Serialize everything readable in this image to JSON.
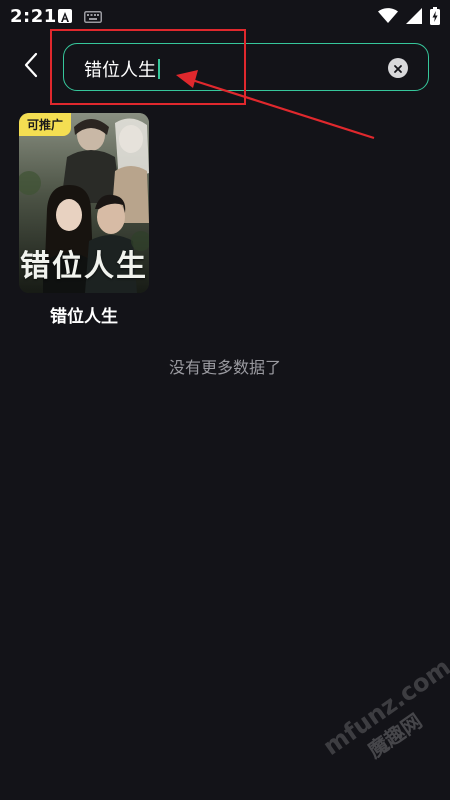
{
  "status_bar": {
    "time": "2:21",
    "icons": [
      "app-notification-icon",
      "keyboard-icon",
      "wifi-icon",
      "signal-icon",
      "battery-charging-icon"
    ]
  },
  "header": {
    "back_icon": "chevron-left-icon",
    "search": {
      "value": "错位人生",
      "clear_icon": "clear-icon"
    }
  },
  "results": [
    {
      "title": "错位人生",
      "poster_title": "错位人生",
      "badge": "可推广"
    }
  ],
  "footer_message": "没有更多数据了",
  "watermark": {
    "cn": "魔趣网",
    "en": "mfunz.com"
  },
  "colors": {
    "background": "#131318",
    "accent": "#36c79b",
    "badge": "#f4de52",
    "annotation": "#e0282d"
  }
}
